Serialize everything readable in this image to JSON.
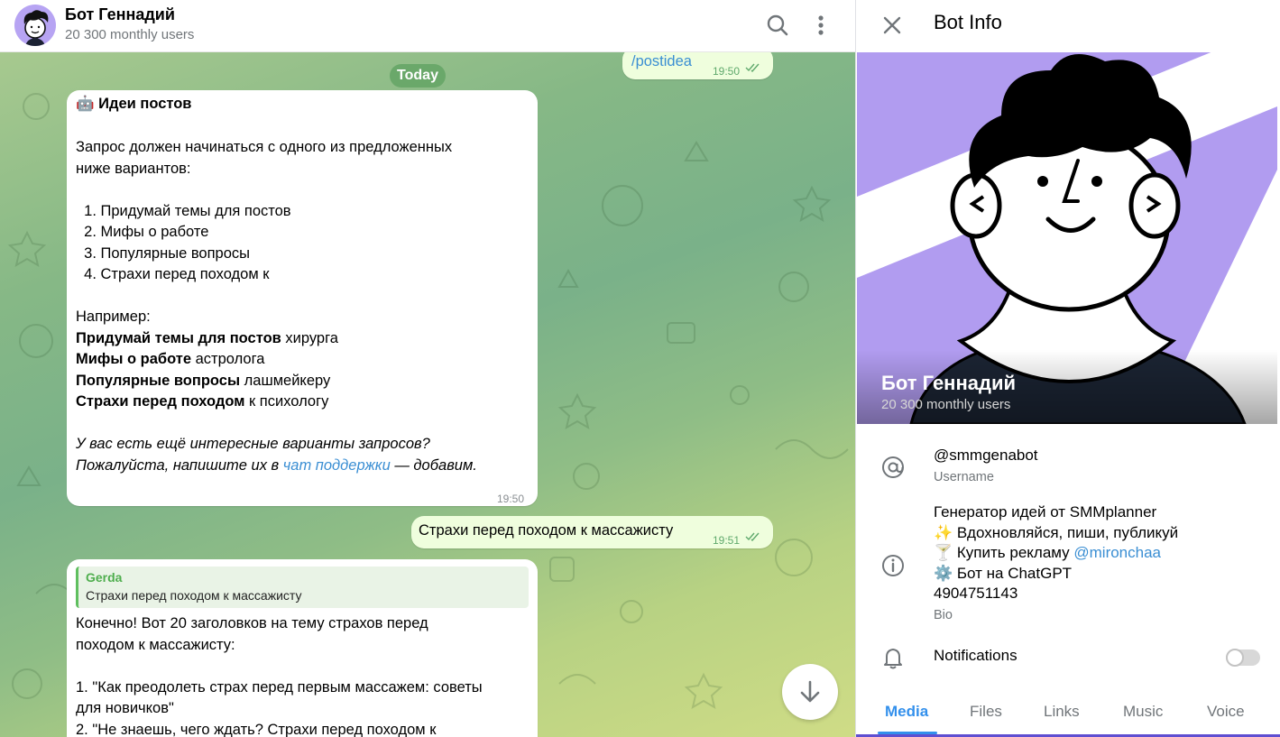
{
  "chat": {
    "title": "Бот Геннадий",
    "subtitle": "20 300 monthly users",
    "date_divider": "Today",
    "messages": [
      {
        "direction": "out",
        "text": "/postidea",
        "time": "19:50",
        "read": true
      },
      {
        "direction": "in",
        "time": "19:50",
        "header": "🤖 Идеи постов",
        "lines": [
          "Запрос должен начинаться с одного из предложенных",
          "ниже вариантов:",
          "  1. Придумай темы для постов",
          "  2. Мифы о работе",
          "  3. Популярные вопросы",
          "  4. Страхи перед походом к",
          "Например:"
        ],
        "examples": [
          {
            "bold": "Придумай темы для постов",
            "rest": " хирурга"
          },
          {
            "bold": "Мифы о работе",
            "rest": " астролога"
          },
          {
            "bold": "Популярные вопросы",
            "rest": " лашмейкеру"
          },
          {
            "bold": "Страхи перед походом",
            "rest": " к психологу"
          }
        ],
        "italic_1": "У вас есть ещё интересные варианты запросов?",
        "italic_2_pre": "Пожалуйста, напишите их в ",
        "italic_2_link": "чат поддержки",
        "italic_2_post": " — добавим."
      },
      {
        "direction": "out",
        "text": "Страхи перед походом к массажисту",
        "time": "19:51",
        "read": true
      },
      {
        "direction": "in",
        "reply_name": "Gerda",
        "reply_text": "Страхи перед походом к массажисту",
        "lines": [
          "Конечно! Вот 20 заголовков на тему страхов перед",
          "походом к массажисту:",
          "1. \"Как преодолеть страх перед первым массажем: советы",
          "для новичков\"",
          "2. \"Не знаешь, чего ждать? Страхи перед походом к"
        ]
      }
    ]
  },
  "info": {
    "title": "Bot Info",
    "name": "Бот Геннадий",
    "subtitle": "20 300 monthly users",
    "username": "@smmgenabot",
    "username_label": "Username",
    "bio_lines": [
      "Генератор идей от SMMplanner",
      "✨ Вдохновляйся, пиши, публикуй",
      "🍸 Купить рекламу ",
      "⚙️ Бот на ChatGPT",
      "4904751143"
    ],
    "bio_link": "@mironchaa",
    "bio_label": "Bio",
    "notifications_label": "Notifications",
    "notifications_on": false,
    "tabs": [
      "Media",
      "Files",
      "Links",
      "Music",
      "Voice"
    ],
    "active_tab": "Media"
  },
  "colors": {
    "accent": "#3390ec",
    "link": "#3a8ed3",
    "outgoing_bubble": "#effedd",
    "avatar_bg": "#b19cf0"
  },
  "icons": [
    "search-icon",
    "more-vertical-icon",
    "close-icon",
    "at-sign-icon",
    "info-icon",
    "bell-icon",
    "arrow-down-icon",
    "double-check-icon"
  ]
}
